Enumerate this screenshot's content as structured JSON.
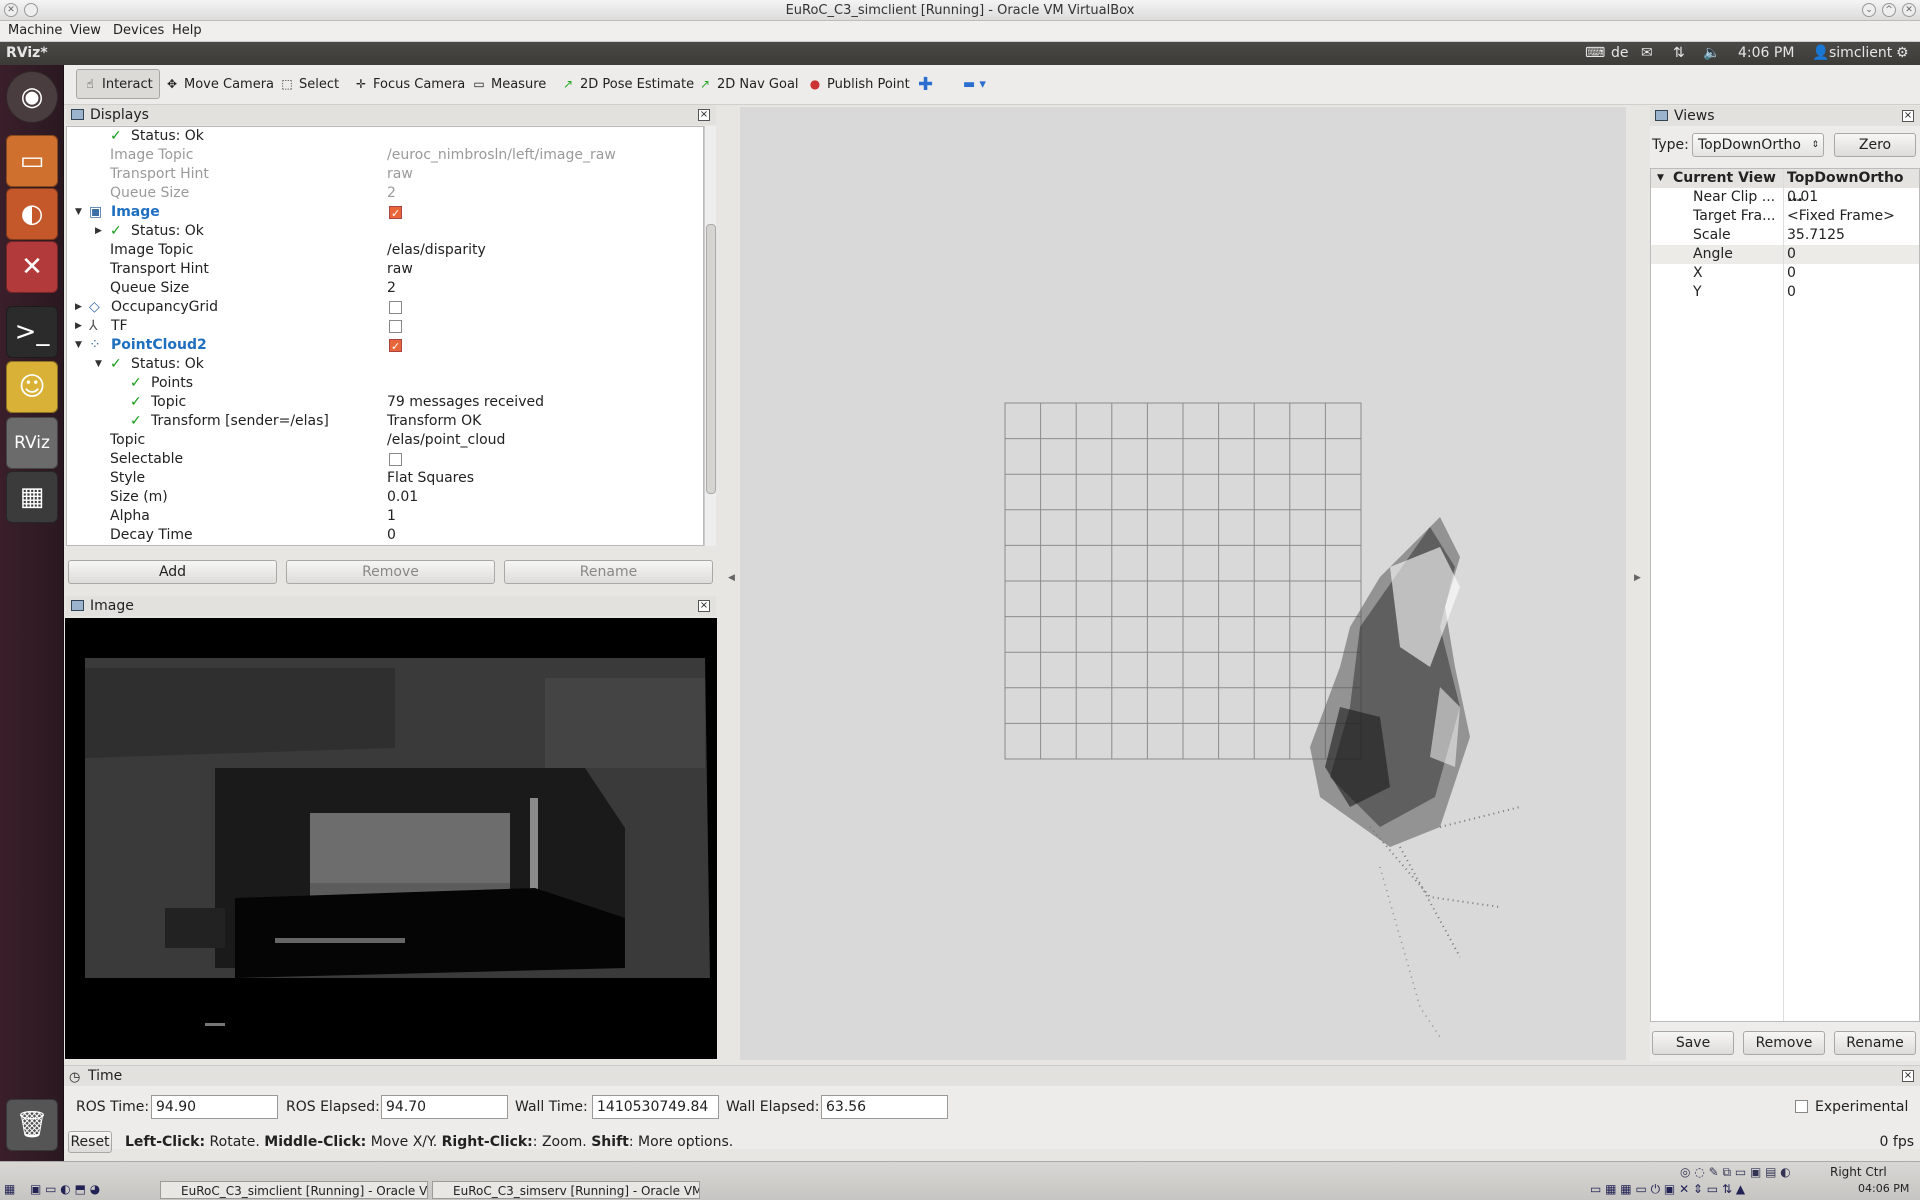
{
  "vbox": {
    "title": "EuRoC_C3_simclient [Running] - Oracle VM VirtualBox",
    "menu": [
      "Machine",
      "View",
      "Devices",
      "Help"
    ]
  },
  "panel": {
    "app": "RViz*",
    "kbd": "de",
    "time": "4:06 PM",
    "user": "simclient"
  },
  "toolbar": {
    "interact": "Interact",
    "move_camera": "Move Camera",
    "select": "Select",
    "focus_camera": "Focus Camera",
    "measure": "Measure",
    "pose": "2D Pose Estimate",
    "nav": "2D Nav Goal",
    "publish": "Publish Point"
  },
  "displays": {
    "title": "Displays",
    "rows": [
      {
        "k": "Status: Ok",
        "v": ""
      },
      {
        "k": "Image Topic",
        "v": "/euroc_nimbrosln/left/image_raw"
      },
      {
        "k": "Transport Hint",
        "v": "raw"
      },
      {
        "k": "Queue Size",
        "v": "2"
      },
      {
        "k": "Image",
        "v": ""
      },
      {
        "k": "Status: Ok",
        "v": ""
      },
      {
        "k": "Image Topic",
        "v": "/elas/disparity"
      },
      {
        "k": "Transport Hint",
        "v": "raw"
      },
      {
        "k": "Queue Size",
        "v": "2"
      },
      {
        "k": "OccupancyGrid",
        "v": ""
      },
      {
        "k": "TF",
        "v": ""
      },
      {
        "k": "PointCloud2",
        "v": ""
      },
      {
        "k": "Status: Ok",
        "v": ""
      },
      {
        "k": "Points",
        "v": ""
      },
      {
        "k": "Topic",
        "v": "79 messages received"
      },
      {
        "k": "Transform [sender=/elas]",
        "v": "Transform OK"
      },
      {
        "k": "Topic",
        "v": "/elas/point_cloud"
      },
      {
        "k": "Selectable",
        "v": ""
      },
      {
        "k": "Style",
        "v": "Flat Squares"
      },
      {
        "k": "Size (m)",
        "v": "0.01"
      },
      {
        "k": "Alpha",
        "v": "1"
      },
      {
        "k": "Decay Time",
        "v": "0"
      }
    ],
    "buttons": {
      "add": "Add",
      "remove": "Remove",
      "rename": "Rename"
    }
  },
  "image_panel": {
    "title": "Image"
  },
  "views": {
    "title": "Views",
    "type_label": "Type:",
    "type_value": "TopDownOrtho",
    "zero": "Zero",
    "current_view": "Current View",
    "current_view_value": "TopDownOrtho ...",
    "rows": [
      {
        "k": "Near Clip ...",
        "v": "0.01"
      },
      {
        "k": "Target Fra...",
        "v": "<Fixed Frame>"
      },
      {
        "k": "Scale",
        "v": "35.7125"
      },
      {
        "k": "Angle",
        "v": "0"
      },
      {
        "k": "X",
        "v": "0"
      },
      {
        "k": "Y",
        "v": "0"
      }
    ],
    "buttons": {
      "save": "Save",
      "remove": "Remove",
      "rename": "Rename"
    }
  },
  "time": {
    "title": "Time",
    "ros_time_label": "ROS Time:",
    "ros_time": "94.90",
    "ros_elapsed_label": "ROS Elapsed:",
    "ros_elapsed": "94.70",
    "wall_time_label": "Wall Time:",
    "wall_time": "1410530749.84",
    "wall_elapsed_label": "Wall Elapsed:",
    "wall_elapsed": "63.56",
    "experimental": "Experimental",
    "reset": "Reset",
    "hint_left_b": "Left-Click:",
    "hint_left": " Rotate. ",
    "hint_mid_b": "Middle-Click:",
    "hint_mid": " Move X/Y. ",
    "hint_right_b": "Right-Click:",
    "hint_right": ": Zoom. ",
    "hint_shift_b": "Shift",
    "hint_shift": ": More options.",
    "fps": "0 fps"
  },
  "taskbar": {
    "task1": "EuRoC_C3_simclient [Running] - Oracle VM V...",
    "task2": "EuRoC_C3_simserv [Running] - Oracle VM Vi...",
    "host_key": "Right Ctrl",
    "clock": "04:06 PM"
  }
}
